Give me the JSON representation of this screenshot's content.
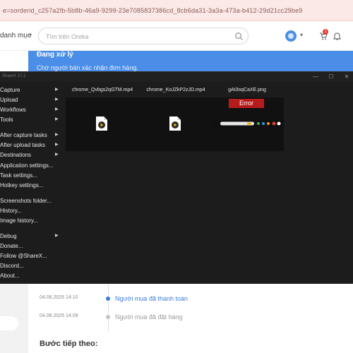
{
  "browser": {
    "url": "e=sorderid_c257a2fb-5b8b-46a9-9299-23e7085837386cd_8cb6da31-3a3a-473a-b412-29d21cc29be9"
  },
  "header": {
    "categories_label": "danh mục",
    "search_placeholder": "Tìm trên Oreka",
    "cart_count": "1"
  },
  "order_status": {
    "title": "Đang xử lý",
    "subtitle": "Chờ người bán xác nhận đơn hàng."
  },
  "timeline": [
    {
      "time": "04.08.2025 14:10",
      "text": "Người mua đã thanh toán",
      "color": "#3b7ddd"
    },
    {
      "time": "04.08.2025 14:09",
      "text": "Người mua đã đặt hàng",
      "color": "#9a9a9a"
    }
  ],
  "next_steps_label": "Bước tiếp theo:",
  "sharex": {
    "window_title": "ShareX 17.1",
    "window_buttons": [
      "—",
      "☐",
      "✕"
    ],
    "menu": [
      {
        "label": "Capture",
        "submenu": true
      },
      {
        "label": "Upload",
        "submenu": true
      },
      {
        "label": "Workflows",
        "submenu": true
      },
      {
        "label": "Tools",
        "submenu": true
      },
      {
        "label": "After capture tasks",
        "submenu": true
      },
      {
        "label": "After upload tasks",
        "submenu": true
      },
      {
        "label": "Destinations",
        "submenu": true
      },
      {
        "label": "Application settings...",
        "submenu": false
      },
      {
        "label": "Task settings...",
        "submenu": false
      },
      {
        "label": "Hotkey settings...",
        "submenu": false
      },
      {
        "label": "Screenshots folder...",
        "submenu": false
      },
      {
        "label": "History...",
        "submenu": false
      },
      {
        "label": "Image history...",
        "submenu": false
      },
      {
        "label": "Debug",
        "submenu": true
      },
      {
        "label": "Donate...",
        "submenu": false
      },
      {
        "label": "Follow @ShareX...",
        "submenu": false
      },
      {
        "label": "Discord...",
        "submenu": false
      },
      {
        "label": "About...",
        "submenu": false
      }
    ],
    "files": [
      {
        "name": "chrome_Qvbgs2qGTM.mp4",
        "kind": "video",
        "error": ""
      },
      {
        "name": "chrome_KoJZkP2zJD.mp4",
        "kind": "video",
        "error": ""
      },
      {
        "name": "gAt3sqCaXE.png",
        "kind": "image",
        "error": "Error"
      }
    ]
  },
  "colors": {
    "accent_blue": "#4a8ee8",
    "error_red": "#b71c1c",
    "sharex_bg": "#1c1c1c",
    "url_bar_bg": "#fbe9e7"
  }
}
